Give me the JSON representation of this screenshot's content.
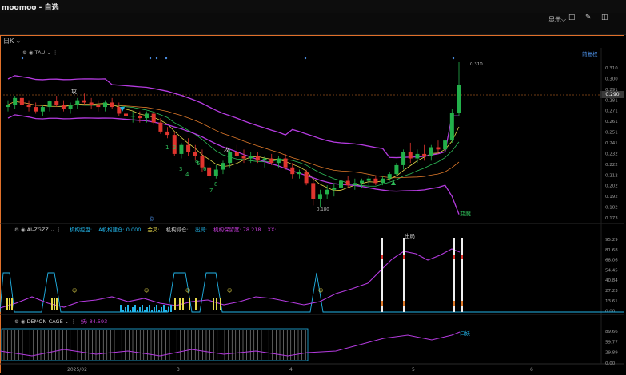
{
  "app": {
    "title": "moomoo - 自选"
  },
  "toolbar": {
    "display_label": "显示",
    "display_chevron": "⌵",
    "layout_icon": "◫",
    "pen_icon": "✎",
    "more_icon": "⋮"
  },
  "chart_tab": {
    "label": "日K"
  },
  "main_indicator": {
    "name": "TAU",
    "adjust_label": "前复权"
  },
  "ind1": {
    "name": "AI-ZGZZ",
    "fields": [
      {
        "label": "机构控盘:",
        "value": "",
        "color": "#22b4e8"
      },
      {
        "label": "A机构建仓:",
        "value": "0.000",
        "color": "#22b4e8"
      },
      {
        "label": "金叉:",
        "value": "",
        "color": "#e6d84a"
      },
      {
        "label": "机构减仓:",
        "value": "",
        "color": "#c8c8c8"
      },
      {
        "label": "出局:",
        "value": "",
        "color": "#22b4e8"
      },
      {
        "label": "机构保留度:",
        "value": "78.218",
        "color": "#c43cd8"
      },
      {
        "label": "XX:",
        "value": "",
        "color": "#c43cd8"
      }
    ]
  },
  "ind2": {
    "name": "DEMON-CAGE",
    "field_label": "妖:",
    "field_value": "84.593"
  },
  "annotations": {
    "high_price": "0.310",
    "low_price": "0.180",
    "bias_label": "变魔",
    "exit_label": "出局",
    "demon_label": "口妖",
    "gong": "攻",
    "low_marker": "©"
  },
  "labels": [
    "1",
    "2",
    "3",
    "4",
    "5",
    "6",
    "7",
    "8",
    "9"
  ],
  "colors": {
    "up": "#22b04a",
    "down": "#e0352e",
    "purple": "#b53be0",
    "orange": "#e07a2a",
    "yellow": "#e6d84a",
    "cyan": "#22b4e8",
    "green_ma": "#2fbf5a"
  },
  "chart_data": {
    "type": "candlestick",
    "x_labels": [
      "2025/02",
      "3",
      "4",
      "5",
      "6"
    ],
    "y_ticks": [
      "0.310",
      "0.300",
      "0.291",
      "0.281",
      "0.271",
      "0.261",
      "0.251",
      "0.241",
      "0.232",
      "0.222",
      "0.212",
      "0.202",
      "0.192",
      "0.182",
      "0.173"
    ],
    "ylim": [
      0.173,
      0.31
    ],
    "last_price": "0.290",
    "candles": [
      {
        "o": 0.27,
        "h": 0.276,
        "l": 0.266,
        "c": 0.272
      },
      {
        "o": 0.272,
        "h": 0.28,
        "l": 0.268,
        "c": 0.278
      },
      {
        "o": 0.278,
        "h": 0.284,
        "l": 0.27,
        "c": 0.272
      },
      {
        "o": 0.272,
        "h": 0.276,
        "l": 0.266,
        "c": 0.27
      },
      {
        "o": 0.27,
        "h": 0.274,
        "l": 0.264,
        "c": 0.266
      },
      {
        "o": 0.266,
        "h": 0.272,
        "l": 0.262,
        "c": 0.27
      },
      {
        "o": 0.27,
        "h": 0.276,
        "l": 0.266,
        "c": 0.275
      },
      {
        "o": 0.275,
        "h": 0.28,
        "l": 0.27,
        "c": 0.272
      },
      {
        "o": 0.272,
        "h": 0.276,
        "l": 0.266,
        "c": 0.268
      },
      {
        "o": 0.268,
        "h": 0.274,
        "l": 0.264,
        "c": 0.272
      },
      {
        "o": 0.272,
        "h": 0.278,
        "l": 0.268,
        "c": 0.276
      },
      {
        "o": 0.276,
        "h": 0.282,
        "l": 0.272,
        "c": 0.274
      },
      {
        "o": 0.274,
        "h": 0.278,
        "l": 0.268,
        "c": 0.272
      },
      {
        "o": 0.272,
        "h": 0.276,
        "l": 0.266,
        "c": 0.27
      },
      {
        "o": 0.27,
        "h": 0.276,
        "l": 0.266,
        "c": 0.274
      },
      {
        "o": 0.274,
        "h": 0.278,
        "l": 0.268,
        "c": 0.27
      },
      {
        "o": 0.27,
        "h": 0.274,
        "l": 0.262,
        "c": 0.264
      },
      {
        "o": 0.264,
        "h": 0.268,
        "l": 0.258,
        "c": 0.262
      },
      {
        "o": 0.262,
        "h": 0.266,
        "l": 0.256,
        "c": 0.262
      },
      {
        "o": 0.262,
        "h": 0.266,
        "l": 0.256,
        "c": 0.26
      },
      {
        "o": 0.26,
        "h": 0.266,
        "l": 0.256,
        "c": 0.264
      },
      {
        "o": 0.264,
        "h": 0.266,
        "l": 0.254,
        "c": 0.256
      },
      {
        "o": 0.256,
        "h": 0.26,
        "l": 0.246,
        "c": 0.248
      },
      {
        "o": 0.248,
        "h": 0.252,
        "l": 0.242,
        "c": 0.245
      },
      {
        "o": 0.245,
        "h": 0.248,
        "l": 0.226,
        "c": 0.228
      },
      {
        "o": 0.228,
        "h": 0.238,
        "l": 0.224,
        "c": 0.236
      },
      {
        "o": 0.236,
        "h": 0.242,
        "l": 0.226,
        "c": 0.23
      },
      {
        "o": 0.23,
        "h": 0.236,
        "l": 0.222,
        "c": 0.226
      },
      {
        "o": 0.226,
        "h": 0.232,
        "l": 0.212,
        "c": 0.216
      },
      {
        "o": 0.216,
        "h": 0.22,
        "l": 0.204,
        "c": 0.208
      },
      {
        "o": 0.208,
        "h": 0.218,
        "l": 0.206,
        "c": 0.214
      },
      {
        "o": 0.214,
        "h": 0.222,
        "l": 0.21,
        "c": 0.22
      },
      {
        "o": 0.22,
        "h": 0.232,
        "l": 0.216,
        "c": 0.23
      },
      {
        "o": 0.23,
        "h": 0.236,
        "l": 0.222,
        "c": 0.226
      },
      {
        "o": 0.226,
        "h": 0.232,
        "l": 0.22,
        "c": 0.224
      },
      {
        "o": 0.224,
        "h": 0.23,
        "l": 0.22,
        "c": 0.226
      },
      {
        "o": 0.226,
        "h": 0.23,
        "l": 0.22,
        "c": 0.222
      },
      {
        "o": 0.222,
        "h": 0.226,
        "l": 0.216,
        "c": 0.224
      },
      {
        "o": 0.224,
        "h": 0.228,
        "l": 0.218,
        "c": 0.22
      },
      {
        "o": 0.22,
        "h": 0.226,
        "l": 0.216,
        "c": 0.224
      },
      {
        "o": 0.224,
        "h": 0.228,
        "l": 0.214,
        "c": 0.216
      },
      {
        "o": 0.216,
        "h": 0.22,
        "l": 0.206,
        "c": 0.21
      },
      {
        "o": 0.21,
        "h": 0.214,
        "l": 0.206,
        "c": 0.212
      },
      {
        "o": 0.212,
        "h": 0.214,
        "l": 0.2,
        "c": 0.202
      },
      {
        "o": 0.202,
        "h": 0.206,
        "l": 0.182,
        "c": 0.188
      },
      {
        "o": 0.188,
        "h": 0.196,
        "l": 0.18,
        "c": 0.192
      },
      {
        "o": 0.192,
        "h": 0.2,
        "l": 0.188,
        "c": 0.196
      },
      {
        "o": 0.196,
        "h": 0.202,
        "l": 0.19,
        "c": 0.198
      },
      {
        "o": 0.198,
        "h": 0.206,
        "l": 0.194,
        "c": 0.204
      },
      {
        "o": 0.204,
        "h": 0.208,
        "l": 0.198,
        "c": 0.2
      },
      {
        "o": 0.2,
        "h": 0.206,
        "l": 0.196,
        "c": 0.202
      },
      {
        "o": 0.202,
        "h": 0.206,
        "l": 0.198,
        "c": 0.204
      },
      {
        "o": 0.204,
        "h": 0.208,
        "l": 0.2,
        "c": 0.206
      },
      {
        "o": 0.206,
        "h": 0.208,
        "l": 0.2,
        "c": 0.202
      },
      {
        "o": 0.202,
        "h": 0.208,
        "l": 0.2,
        "c": 0.206
      },
      {
        "o": 0.206,
        "h": 0.212,
        "l": 0.204,
        "c": 0.21
      },
      {
        "o": 0.21,
        "h": 0.22,
        "l": 0.208,
        "c": 0.218
      },
      {
        "o": 0.218,
        "h": 0.232,
        "l": 0.214,
        "c": 0.23
      },
      {
        "o": 0.23,
        "h": 0.238,
        "l": 0.22,
        "c": 0.224
      },
      {
        "o": 0.224,
        "h": 0.232,
        "l": 0.22,
        "c": 0.228
      },
      {
        "o": 0.228,
        "h": 0.236,
        "l": 0.222,
        "c": 0.226
      },
      {
        "o": 0.226,
        "h": 0.236,
        "l": 0.222,
        "c": 0.234
      },
      {
        "o": 0.234,
        "h": 0.24,
        "l": 0.228,
        "c": 0.232
      },
      {
        "o": 0.232,
        "h": 0.242,
        "l": 0.23,
        "c": 0.24
      },
      {
        "o": 0.24,
        "h": 0.268,
        "l": 0.238,
        "c": 0.265
      },
      {
        "o": 0.265,
        "h": 0.31,
        "l": 0.262,
        "c": 0.29
      }
    ]
  }
}
